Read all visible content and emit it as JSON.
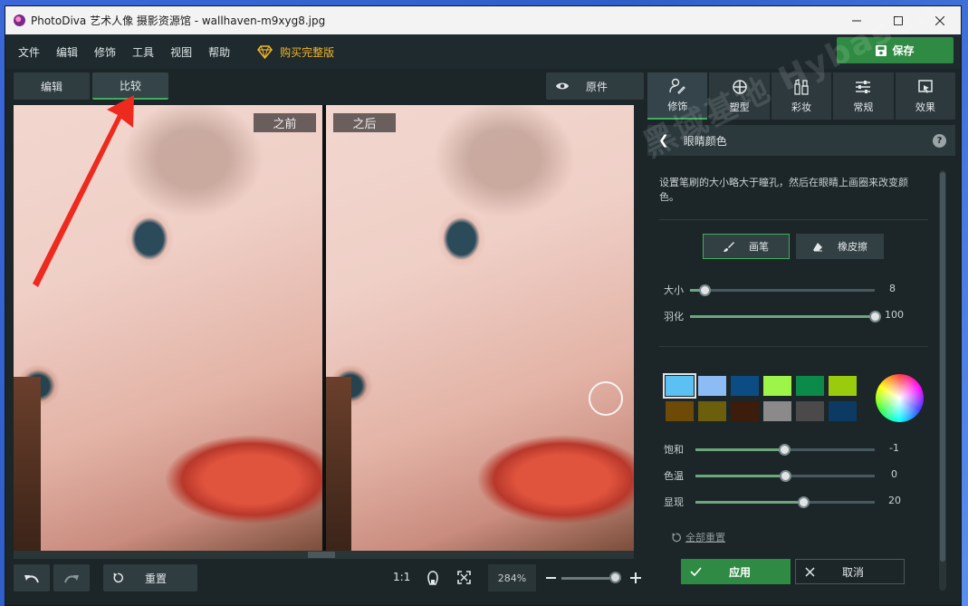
{
  "window": {
    "title": "PhotoDiva 艺术人像 摄影资源馆 - wallhaven-m9xyg8.jpg",
    "controls": [
      "minimize",
      "maximize",
      "close"
    ]
  },
  "menu": {
    "items": [
      "文件",
      "编辑",
      "修饰",
      "工具",
      "视图",
      "帮助"
    ],
    "buy_label": "购买完整版",
    "save_label": "保存"
  },
  "canvas": {
    "tabs": [
      "编辑",
      "比较"
    ],
    "active_tab": "比较",
    "original_label": "原件",
    "before_label": "之前",
    "after_label": "之后"
  },
  "bottombar": {
    "reset_label": "重置",
    "ratio_label": "1:1",
    "zoom": "284%",
    "zoom_level": 0.85
  },
  "panel": {
    "tabs": [
      {
        "label": "修饰",
        "icon": "retouch-icon"
      },
      {
        "label": "塑型",
        "icon": "shape-icon"
      },
      {
        "label": "彩妆",
        "icon": "makeup-icon"
      },
      {
        "label": "常规",
        "icon": "sliders-icon"
      },
      {
        "label": "效果",
        "icon": "effects-icon"
      }
    ],
    "active_tab": "修饰",
    "section_title": "眼睛颜色",
    "description": "设置笔刷的大小略大于瞳孔，然后在眼睛上画圈来改变颜色。",
    "tools": {
      "brush": "画笔",
      "eraser": "橡皮擦"
    },
    "brush_sliders": [
      {
        "label": "大小",
        "value": "8",
        "level": 0.08
      },
      {
        "label": "羽化",
        "value": "100",
        "level": 1.0
      }
    ],
    "swatches": [
      "#5bc0f2",
      "#8dbcf5",
      "#0a4c83",
      "#9ef54a",
      "#0b8a4a",
      "#9acb0d",
      "#6e4a08",
      "#6b5e0c",
      "#3c1c0a",
      "#8a8a8a",
      "#4a4a4a",
      "#0c3a62"
    ],
    "color_sliders": [
      {
        "label": "饱和",
        "value": "-1",
        "level": 0.495
      },
      {
        "label": "色温",
        "value": "0",
        "level": 0.5
      },
      {
        "label": "显现",
        "value": "20",
        "level": 0.6
      }
    ],
    "reset_all_label": "全部重置",
    "apply_label": "应用",
    "cancel_label": "取消"
  },
  "watermark": "黑域基地 Hybase.com",
  "colors": {
    "accent": "#3fae5b",
    "save_green": "#2f8a44",
    "buy_gold": "#f0b428",
    "arrow_red": "#ee2a1e"
  }
}
